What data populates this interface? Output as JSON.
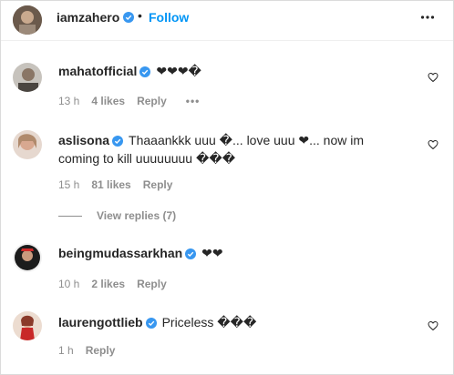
{
  "header": {
    "username": "iamzahero",
    "separator": "•",
    "follow_label": "Follow"
  },
  "comments": [
    {
      "username": "mahatofficial",
      "text": "❤❤❤�",
      "time": "13 h",
      "likes": "4 likes",
      "reply": "Reply",
      "more": "•••"
    },
    {
      "username": "aslisona",
      "text": "Thaaankkk uuu �... love uuu ❤... now im coming to kill uuuuuuuu ���",
      "time": "15 h",
      "likes": "81 likes",
      "reply": "Reply"
    },
    {
      "username": "beingmudassarkhan",
      "text": "❤❤",
      "time": "10 h",
      "likes": "2 likes",
      "reply": "Reply"
    },
    {
      "username": "laurengottlieb",
      "text": "Priceless ���",
      "time": "1 h",
      "reply": "Reply"
    }
  ],
  "view_replies": "View replies (7)",
  "colors": {
    "link": "#0095f6",
    "muted": "#8e8e8e",
    "text": "#262626",
    "verified": "#3897f0"
  }
}
